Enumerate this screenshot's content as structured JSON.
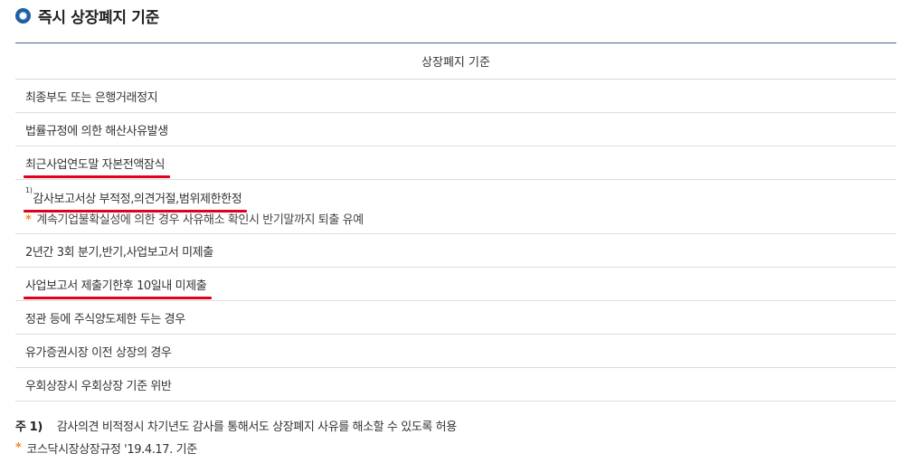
{
  "section": {
    "title": "즉시 상장폐지 기준"
  },
  "table": {
    "header": "상장폐지 기준",
    "rows": [
      {
        "text": "최종부도 또는 은행거래정지",
        "underline": false
      },
      {
        "text": "법률규정에 의한 해산사유발생",
        "underline": false
      },
      {
        "text": "최근사업연도말 자본전액잠식",
        "underline": true
      },
      {
        "marker": "1)",
        "text": "감사보고서상 부적정,의견거절,범위제한한정",
        "underline": true,
        "sub_note": "계속기업불확실성에 의한 경우 사유해소 확인시 반기말까지 퇴출 유예"
      },
      {
        "text": "2년간 3회 분기,반기,사업보고서 미제출",
        "underline": false
      },
      {
        "text": "사업보고서 제출기한후 10일내 미제출",
        "underline": true
      },
      {
        "text": "정관 등에 주식양도제한 두는 경우",
        "underline": false
      },
      {
        "text": "유가증권시장 이전 상장의 경우",
        "underline": false
      },
      {
        "text": "우회상장시 우회상장 기준 위반",
        "underline": false
      }
    ]
  },
  "footnote": {
    "label": "주 1)",
    "text": "감사의견 비적정시 차기년도 감사를 통해서도 상장폐지 사유를 해소할 수 있도록 허용"
  },
  "basis": {
    "text": "코스닥시장상장규정 '19.4.17. 기준"
  },
  "symbols": {
    "star": "*"
  },
  "colors": {
    "accent": "#1f5fa3",
    "underline": "#e0001b",
    "star": "#f08a1e",
    "header_border": "#41648c"
  }
}
